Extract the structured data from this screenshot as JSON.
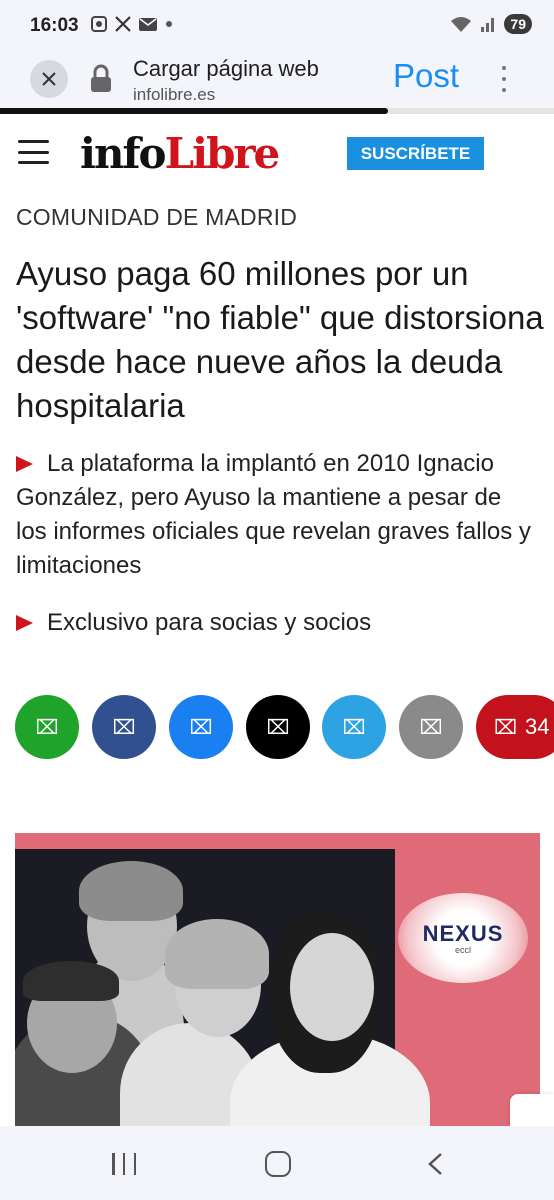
{
  "status_bar": {
    "time": "16:03",
    "battery": "79",
    "icons": [
      "screenshot-icon",
      "x-icon",
      "mail-icon",
      "dot-icon",
      "wifi-icon",
      "signal-icon"
    ]
  },
  "browser": {
    "page_title": "Cargar página web",
    "url": "infolibre.es",
    "action_label": "Post",
    "load_progress": 0.7
  },
  "site": {
    "logo_part1": "info",
    "logo_part2": "Libre",
    "subscribe_label": "SUSCRÍBETE"
  },
  "article": {
    "section": "COMUNIDAD DE MADRID",
    "headline": "Ayuso paga 60 millones por un 'software' \"no fiable\" que distorsiona desde hace nueve años la deuda hospitalaria",
    "bullets": [
      "La plataforma la implantó en 2010 Ignacio González, pero Ayuso la mantiene a pesar de los informes oficiales que revelan graves fallos y limitaciones",
      "Exclusivo para socias y socios"
    ]
  },
  "share": {
    "buttons": [
      {
        "name": "whatsapp",
        "color": "#1fa32b"
      },
      {
        "name": "facebook",
        "color": "#31508f"
      },
      {
        "name": "messenger",
        "color": "#1a7ff0"
      },
      {
        "name": "x",
        "color": "#000000"
      },
      {
        "name": "telegram",
        "color": "#2ea3e4"
      },
      {
        "name": "email",
        "color": "#8a8a8a"
      }
    ],
    "comments_count": "34",
    "comments_color": "#c3121c",
    "placeholder_glyph": "⌧"
  },
  "hero": {
    "badge_main": "NEXUS",
    "badge_sub": "eccl"
  },
  "colors": {
    "brand_red": "#d0141b",
    "brand_blue": "#1b90df",
    "post_blue": "#1b8ef2"
  }
}
